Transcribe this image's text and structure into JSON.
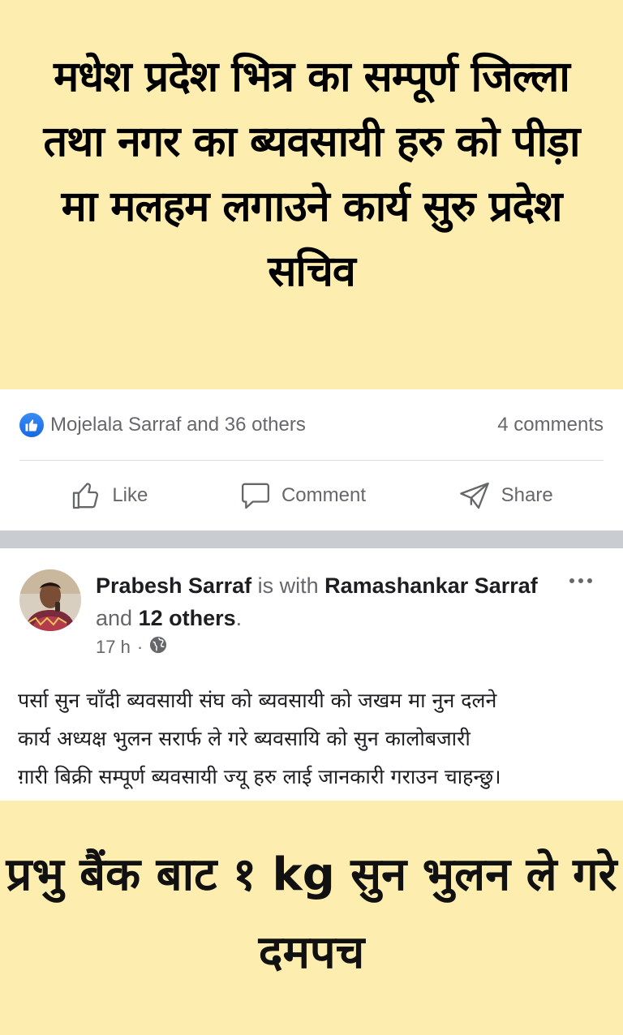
{
  "banner_top": {
    "headline": "मधेश प्रदेश भित्र का सम्पूर्ण जिल्ला तथा नगर का ब्यवसायी हरु को पीड़ा मा मलहम लगाउने कार्य सुरु प्रदेश सचिव",
    "background": "#fdeeb0"
  },
  "reactions": {
    "summary": "Mojelala Sarraf and 36 others",
    "comments": "4 comments",
    "icon": "like-bubble-icon"
  },
  "actions": {
    "like": "Like",
    "comment": "Comment",
    "share": "Share"
  },
  "post": {
    "author": "Prabesh Sarraf",
    "with_text": " is with ",
    "tagged": "Ramashankar Sarraf",
    "and_text": " and ",
    "others": "12 others",
    "period": ".",
    "time": "17 h",
    "dot": "·",
    "privacy_icon": "globe-icon",
    "body_lines": [
      "पर्सा सुन चाँदी ब्यवसायी संघ को ब्यवसायी को जखम मा नुन दलने",
      "कार्य अध्यक्ष भुलन सरार्फ ले गरे ब्यवसायि को सुन कालोबजारी",
      "ग़ारी बिक्री सम्पूर्ण ब्यवसायी ज्यू हरु लाई जानकारी गराउन चाहन्छु।"
    ]
  },
  "banner_bottom": {
    "headline": "प्रभु बैंक बाट १ kg सुन भुलन ले गरे दमपच"
  },
  "colors": {
    "accent": "#1877f2",
    "muted_text": "#65676b",
    "separator": "#c9ccd1"
  }
}
